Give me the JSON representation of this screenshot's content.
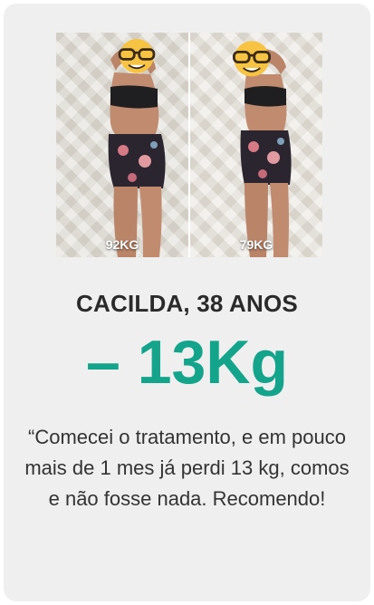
{
  "testimonial": {
    "photos": {
      "before_label": "92KG",
      "after_label": "79KG"
    },
    "name": "CACILDA, 38 ANOS",
    "weight_loss": "– 13Kg",
    "quote": "“Comecei o tratamento, e em pouco mais de 1 mes já perdi 13 kg, comos e não fosse nada. Recomendo!"
  },
  "colors": {
    "accent": "#14a38b",
    "card_background": "#efefef",
    "text": "#2a2a2a"
  },
  "icons": [
    "nerd-face-emoji-icon"
  ]
}
